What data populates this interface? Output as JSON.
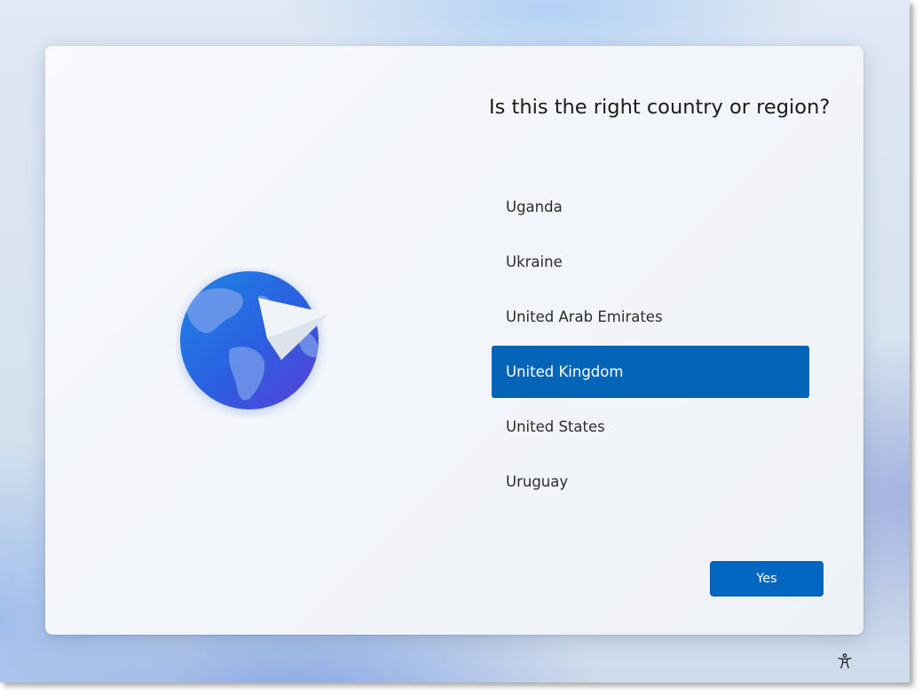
{
  "dialog": {
    "question": "Is this the right country or region?",
    "countries": [
      {
        "label": "Uganda",
        "selected": false
      },
      {
        "label": "Ukraine",
        "selected": false
      },
      {
        "label": "United Arab Emirates",
        "selected": false
      },
      {
        "label": "United Kingdom",
        "selected": true
      },
      {
        "label": "United States",
        "selected": false
      },
      {
        "label": "Uruguay",
        "selected": false
      }
    ],
    "yes_label": "Yes"
  },
  "icons": {
    "illustration": "globe-with-paper-plane-icon",
    "accessibility": "accessibility-icon"
  },
  "colors": {
    "accent": "#0067c0",
    "selected_row": "#0364b8"
  }
}
